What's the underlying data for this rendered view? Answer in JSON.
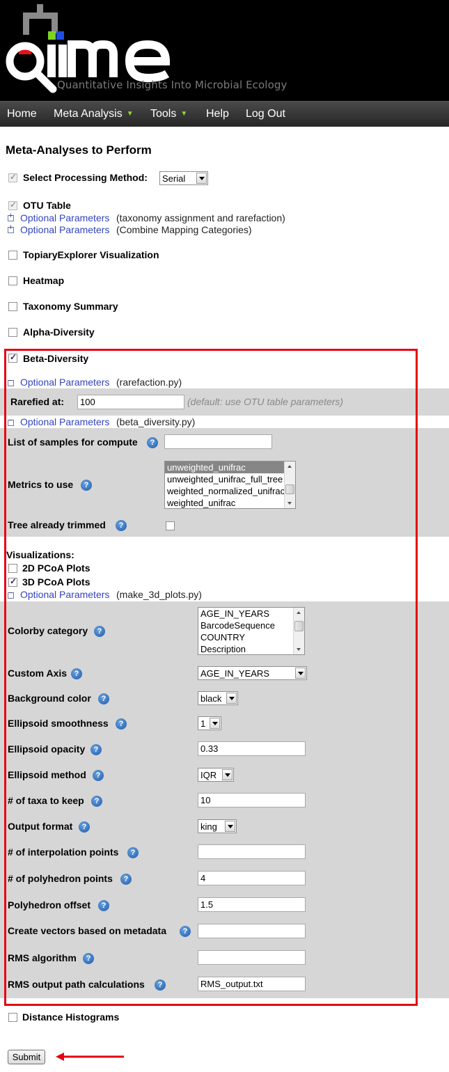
{
  "header": {
    "logo_text": "qiime",
    "tagline": "Quantitative Insights Into Microbial Ecology"
  },
  "nav": {
    "items": [
      {
        "label": "Home"
      },
      {
        "label": "Meta Analysis",
        "dropdown": true
      },
      {
        "label": "Tools",
        "dropdown": true
      },
      {
        "label": "Help"
      },
      {
        "label": "Log Out"
      }
    ]
  },
  "page": {
    "title": "Meta-Analyses to Perform"
  },
  "processing": {
    "label": "Select Processing Method:",
    "checked": true,
    "value": "Serial"
  },
  "otu": {
    "label": "OTU Table",
    "checked": true,
    "opt1_link": "Optional Parameters",
    "opt1_note": "(taxonomy assignment and rarefaction)",
    "opt2_link": "Optional Parameters",
    "opt2_note": "(Combine Mapping Categories)"
  },
  "analyses": {
    "topiary": "TopiaryExplorer Visualization",
    "heatmap": "Heatmap",
    "taxonomy": "Taxonomy Summary",
    "alpha": "Alpha-Diversity",
    "beta": "Beta-Diversity",
    "distance": "Distance Histograms"
  },
  "beta": {
    "checked": true,
    "rare_link": "Optional Parameters",
    "rare_note": "(rarefaction.py)",
    "rarefied_label": "Rarefied at:",
    "rarefied_value": "100",
    "rarefied_note": "(default: use OTU table parameters)",
    "bd_link": "Optional Parameters",
    "bd_note": "(beta_diversity.py)",
    "samples_label": "List of samples for compute",
    "samples_value": "",
    "metrics_label": "Metrics to use",
    "metrics_options": [
      "unweighted_unifrac",
      "unweighted_unifrac_full_tree",
      "weighted_normalized_unifrac",
      "weighted_unifrac"
    ],
    "metrics_selected": "unweighted_unifrac",
    "tree_label": "Tree already trimmed",
    "tree_checked": false
  },
  "viz": {
    "heading": "Visualizations:",
    "pcoa2d": "2D PCoA Plots",
    "pcoa2d_checked": false,
    "pcoa3d": "3D PCoA Plots",
    "pcoa3d_checked": true,
    "plots_link": "Optional Parameters",
    "plots_note": "(make_3d_plots.py)"
  },
  "plots": {
    "colorby_label": "Colorby category",
    "colorby_options": [
      "AGE_IN_YEARS",
      "BarcodeSequence",
      "COUNTRY",
      "Description"
    ],
    "custom_axis_label": "Custom Axis",
    "custom_axis_value": "AGE_IN_YEARS",
    "background_label": "Background color",
    "background_value": "black",
    "smoothness_label": "Ellipsoid smoothness",
    "smoothness_value": "1",
    "opacity_label": "Ellipsoid opacity",
    "opacity_value": "0.33",
    "method_label": "Ellipsoid method",
    "method_value": "IQR",
    "taxa_label": "# of taxa to keep",
    "taxa_value": "10",
    "format_label": "Output format",
    "format_value": "king",
    "interp_label": "# of interpolation points",
    "interp_value": "",
    "polypoints_label": "# of polyhedron points",
    "polypoints_value": "4",
    "polyoffset_label": "Polyhedron offset",
    "polyoffset_value": "1.5",
    "vectors_label": "Create vectors based on metadata",
    "vectors_value": "",
    "rms_label": "RMS algorithm",
    "rms_value": "",
    "rmspath_label": "RMS output path calculations",
    "rmspath_value": "RMS_output.txt"
  },
  "help_icon": "question-mark",
  "submit": {
    "label": "Submit"
  },
  "colors": {
    "annotation_red": "#e30613",
    "nav_arrow_green": "#9bd33a",
    "link_blue": "#3344bb"
  }
}
